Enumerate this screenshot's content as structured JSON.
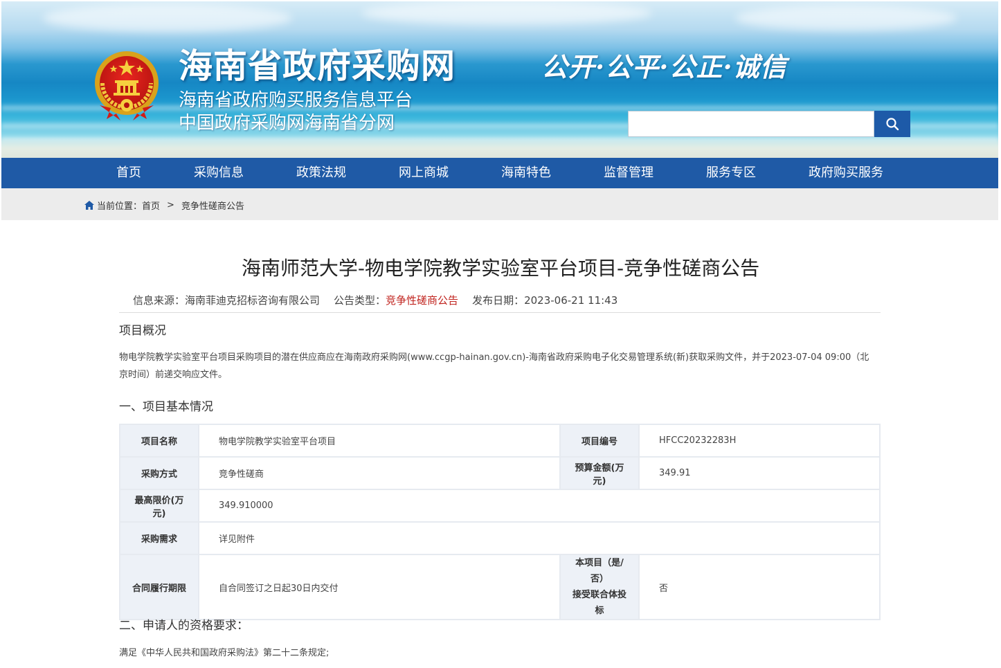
{
  "header": {
    "title": "海南省政府采购网",
    "subtitle_1": "海南省政府购买服务信息平台",
    "subtitle_2": "中国政府采购网海南省分网",
    "slogan": "公开·公平·公正·诚信",
    "search": {
      "value": "",
      "placeholder": ""
    },
    "colors": {
      "nav_bg": "#1f5aa6",
      "search_btn": "#1d5aa8",
      "accent_red": "#c0231e"
    }
  },
  "nav": {
    "items": [
      {
        "label": "首页"
      },
      {
        "label": "采购信息"
      },
      {
        "label": "政策法规"
      },
      {
        "label": "网上商城"
      },
      {
        "label": "海南特色"
      },
      {
        "label": "监督管理"
      },
      {
        "label": "服务专区"
      },
      {
        "label": "政府购买服务"
      }
    ]
  },
  "breadcrumb": {
    "prefix": "当前位置：",
    "home": "首页",
    "separator": ">",
    "current": "竞争性磋商公告"
  },
  "article": {
    "title": "海南师范大学-物电学院教学实验室平台项目-竞争性磋商公告",
    "meta": {
      "source_label": "信息来源：",
      "source": "海南菲迪克招标咨询有限公司",
      "type_label": "公告类型：",
      "type": "竞争性磋商公告",
      "date_label": "发布日期：",
      "date": "2023-06-21 11:43"
    },
    "overview_heading": "项目概况",
    "overview_text": "物电学院教学实验室平台项目采购项目的潜在供应商应在海南政府采购网(www.ccgp-hainan.gov.cn)-海南省政府采购电子化交易管理系统(新)获取采购文件，并于2023-07-04 09:00（北京时间）前递交响应文件。",
    "section1_heading": "一、项目基本情况",
    "table": {
      "project_name_label": "项目名称",
      "project_name": "物电学院教学实验室平台项目",
      "project_no_label": "项目编号",
      "project_no": "HFCC20232283H",
      "method_label": "采购方式",
      "method": "竞争性磋商",
      "budget_label": "预算金额(万元)",
      "budget": "349.91",
      "max_price_label": "最高限价(万元)",
      "max_price": "349.910000",
      "demand_label": "采购需求",
      "demand": "详见附件",
      "period_label": "合同履行期限",
      "period": "自合同签订之日起30日内交付",
      "consortium_label_1": "本项目（是/否）",
      "consortium_label_2": "接受联合体投标",
      "consortium": "否"
    },
    "section2_heading": "二、申请人的资格要求：",
    "section2_text": "满足《中华人民共和国政府采购法》第二十二条规定;"
  }
}
